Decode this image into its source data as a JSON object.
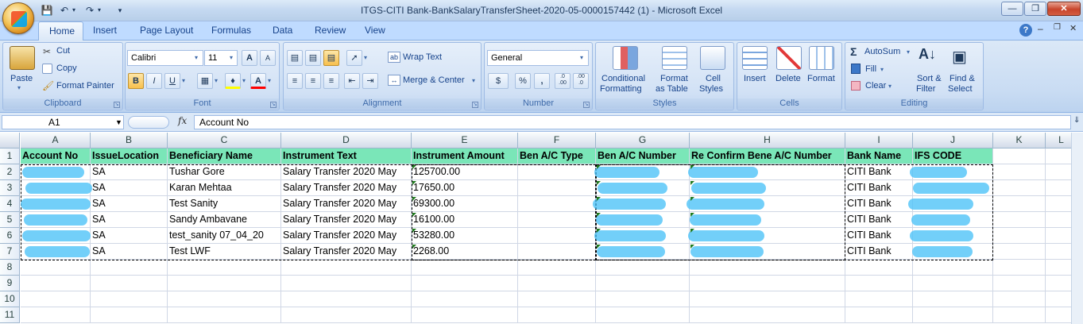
{
  "window": {
    "title": "ITGS-CITI Bank-BankSalaryTransferSheet-2020-05-0000157442 (1)  -  Microsoft Excel"
  },
  "ribbon_tabs": [
    "Home",
    "Insert",
    "Page Layout",
    "Formulas",
    "Data",
    "Review",
    "View"
  ],
  "clipboard": {
    "paste": "Paste",
    "cut": "Cut",
    "copy": "Copy",
    "format_painter": "Format Painter",
    "title": "Clipboard"
  },
  "font": {
    "name": "Calibri",
    "size": "11",
    "title": "Font",
    "bold": "B",
    "italic": "I",
    "underline": "U",
    "grow": "A",
    "shrink": "A",
    "color_letter": "A"
  },
  "alignment": {
    "wrap": "Wrap Text",
    "merge": "Merge & Center",
    "title": "Alignment"
  },
  "number": {
    "format": "General",
    "title": "Number",
    "percent": "%",
    "comma": ",",
    "inc": ".0\n.00",
    "dec": ".00\n.0"
  },
  "styles": {
    "conditional": [
      "Conditional",
      "Formatting"
    ],
    "as_table": [
      "Format",
      "as Table"
    ],
    "cell_styles": [
      "Cell",
      "Styles"
    ],
    "title": "Styles"
  },
  "cells": {
    "insert": "Insert",
    "delete": "Delete",
    "format": "Format",
    "title": "Cells"
  },
  "editing": {
    "autosum": "AutoSum",
    "fill": "Fill",
    "clear": "Clear",
    "sort": [
      "Sort &",
      "Filter"
    ],
    "find": [
      "Find &",
      "Select"
    ],
    "title": "Editing"
  },
  "formula_bar": {
    "name_box": "A1",
    "fx": "fx",
    "content": "Account No"
  },
  "sheet": {
    "columns": [
      "A",
      "B",
      "C",
      "D",
      "E",
      "F",
      "G",
      "H",
      "I",
      "J",
      "K",
      "L"
    ],
    "row_numbers": [
      "1",
      "2",
      "3",
      "4",
      "5",
      "6",
      "7",
      "8",
      "9",
      "10",
      "11"
    ],
    "header": [
      "Account No",
      "IssueLocation",
      "Beneficiary Name",
      "Instrument Text",
      "Instrument Amount",
      "Ben A/C Type",
      "Ben A/C Number",
      "Re Confirm Bene A/C Number",
      "Bank Name",
      "IFS CODE"
    ],
    "rows": [
      [
        "",
        "SA",
        "Tushar Gore",
        "Salary Transfer 2020 May",
        "125700.00",
        "",
        "",
        "",
        "CITI Bank",
        ""
      ],
      [
        "",
        "SA",
        "Karan Mehtaa",
        "Salary Transfer 2020 May",
        "17650.00",
        "",
        "",
        "",
        "CITI Bank",
        ""
      ],
      [
        "",
        "SA",
        "Test Sanity",
        "Salary Transfer 2020 May",
        "69300.00",
        "",
        "",
        "",
        "CITI Bank",
        ""
      ],
      [
        "",
        "SA",
        "Sandy Ambavane",
        "Salary Transfer 2020 May",
        "16100.00",
        "",
        "",
        "",
        "CITI Bank",
        ""
      ],
      [
        "",
        "SA",
        "test_sanity 07_04_20",
        "Salary Transfer 2020 May",
        "53280.00",
        "",
        "",
        "",
        "CITI Bank",
        ""
      ],
      [
        "",
        "SA",
        "Test LWF",
        "Salary Transfer 2020 May",
        "2268.00",
        "",
        "",
        "",
        "CITI Bank",
        ""
      ]
    ]
  },
  "colors": {
    "header_fill": "#7ae6b8",
    "redaction": "#4fc3f7",
    "ribbon": "#dbe8f7"
  }
}
